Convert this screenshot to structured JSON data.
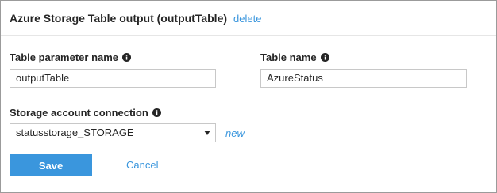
{
  "panel": {
    "title": "Azure Storage Table output (outputTable)",
    "delete_label": "delete"
  },
  "fields": {
    "table_parameter_name": {
      "label": "Table parameter name",
      "value": "outputTable"
    },
    "table_name": {
      "label": "Table name",
      "value": "AzureStatus"
    },
    "storage_account_connection": {
      "label": "Storage account connection",
      "selected": "statusstorage_STORAGE",
      "new_label": "new"
    }
  },
  "actions": {
    "save_label": "Save",
    "cancel_label": "Cancel"
  },
  "colors": {
    "accent": "#3a96dd",
    "text": "#252525",
    "border": "#c8c8c8"
  }
}
